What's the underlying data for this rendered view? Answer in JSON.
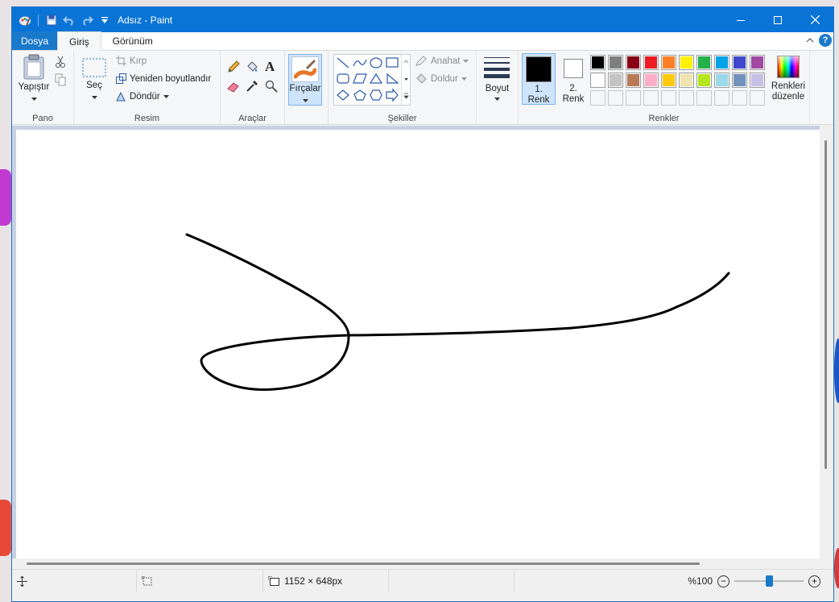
{
  "window": {
    "title": "Adsız - Paint",
    "accent_color": "#0a74d6",
    "controls": [
      "minimize-icon",
      "maximize-icon",
      "close-icon"
    ]
  },
  "tabs": {
    "file": "Dosya",
    "home": "Giriş",
    "view": "Görünüm"
  },
  "ribbon": {
    "clipboard": {
      "group": "Pano",
      "paste": "Yapıştır"
    },
    "image": {
      "group": "Resim",
      "select": "Seç",
      "crop": "Kırp",
      "resize": "Yeniden boyutlandır",
      "rotate": "Döndür"
    },
    "tools": {
      "group": "Araçlar"
    },
    "brushes": {
      "label": "Fırçalar"
    },
    "shapes": {
      "group": "Şekiller",
      "outline": "Anahat",
      "fill": "Doldur"
    },
    "size": {
      "label": "Boyut"
    },
    "color1": {
      "label1": "1.",
      "label2": "Renk",
      "value": "#000000"
    },
    "color2": {
      "label1": "2.",
      "label2": "Renk",
      "value": "#ffffff"
    },
    "colors": {
      "group": "Renkler",
      "edit_line1": "Renkleri",
      "edit_line2": "düzenle",
      "palette_row1": [
        "#000000",
        "#7f7f7f",
        "#880015",
        "#ed1c24",
        "#ff7f27",
        "#fff200",
        "#22b14c",
        "#00a2e8",
        "#3f48cc",
        "#a349a4"
      ],
      "palette_row2": [
        "#ffffff",
        "#c3c3c3",
        "#b97a57",
        "#ffaec9",
        "#ffc90e",
        "#efe4b0",
        "#b5e61d",
        "#99d9ea",
        "#7092be",
        "#c8bfe7"
      ]
    }
  },
  "status": {
    "image_size": "1152 × 648px",
    "zoom": "%100",
    "zoom_fraction": 0.5
  }
}
